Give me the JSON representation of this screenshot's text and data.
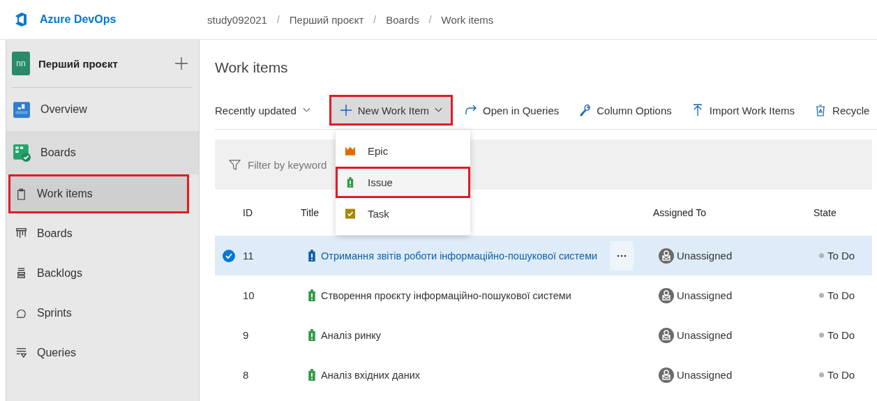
{
  "header": {
    "product": "Azure DevOps",
    "breadcrumb": [
      {
        "kind": "link",
        "text": "study092021"
      },
      {
        "kind": "separator",
        "text": "/"
      },
      {
        "kind": "link",
        "text": "Перший проєкт"
      },
      {
        "kind": "separator",
        "text": "/"
      },
      {
        "kind": "link",
        "text": "Boards"
      },
      {
        "kind": "separator",
        "text": "/"
      },
      {
        "kind": "link",
        "text": "Work items"
      }
    ]
  },
  "sidebar": {
    "project": {
      "initials": "nn",
      "name": "Перший проєкт"
    },
    "items": [
      {
        "label": "Overview",
        "kind": "hub",
        "selected": false,
        "highlighted": false
      },
      {
        "label": "Boards",
        "kind": "hub",
        "selected": true,
        "highlighted": false
      },
      {
        "label": "Work items",
        "kind": "page",
        "selected": true,
        "highlighted": true
      },
      {
        "label": "Boards",
        "kind": "page",
        "selected": false,
        "highlighted": false
      },
      {
        "label": "Backlogs",
        "kind": "page",
        "selected": false,
        "highlighted": false
      },
      {
        "label": "Sprints",
        "kind": "page",
        "selected": false,
        "highlighted": false
      },
      {
        "label": "Queries",
        "kind": "page",
        "selected": false,
        "highlighted": false
      }
    ]
  },
  "page_title": "Work items",
  "toolbar": {
    "sort": "Recently updated",
    "buttons": [
      {
        "label": "New Work Item",
        "kind": "menu",
        "highlighted": true
      },
      {
        "label": "Open in Queries",
        "kind": "plain",
        "highlighted": false
      },
      {
        "label": "Column Options",
        "kind": "plain",
        "highlighted": false
      },
      {
        "label": "Import Work Items",
        "kind": "plain",
        "highlighted": false
      },
      {
        "label": "Recycle",
        "kind": "plain",
        "highlighted": false
      }
    ]
  },
  "filter": {
    "placeholder": "Filter by keyword"
  },
  "new_menu": [
    {
      "label": "Epic",
      "color": "#e06c00",
      "highlighted": false
    },
    {
      "label": "Issue",
      "color": "#339947",
      "highlighted": true
    },
    {
      "label": "Task",
      "color": "#a4880a",
      "highlighted": false
    }
  ],
  "table": {
    "columns": [
      "ID",
      "Title",
      "Assigned To",
      "State"
    ],
    "rows": [
      {
        "id": "11",
        "title": "Отримання звітів роботи інформаційно-пошукової системи",
        "assigned": "Unassigned",
        "state": "To Do",
        "selected": true
      },
      {
        "id": "10",
        "title": "Створення проєкту інформаційно-пошукової системи",
        "assigned": "Unassigned",
        "state": "To Do",
        "selected": false
      },
      {
        "id": "9",
        "title": "Аналіз ринку",
        "assigned": "Unassigned",
        "state": "To Do",
        "selected": false
      },
      {
        "id": "8",
        "title": "Аналіз вхідних даних",
        "assigned": "Unassigned",
        "state": "To Do",
        "selected": false
      }
    ]
  }
}
